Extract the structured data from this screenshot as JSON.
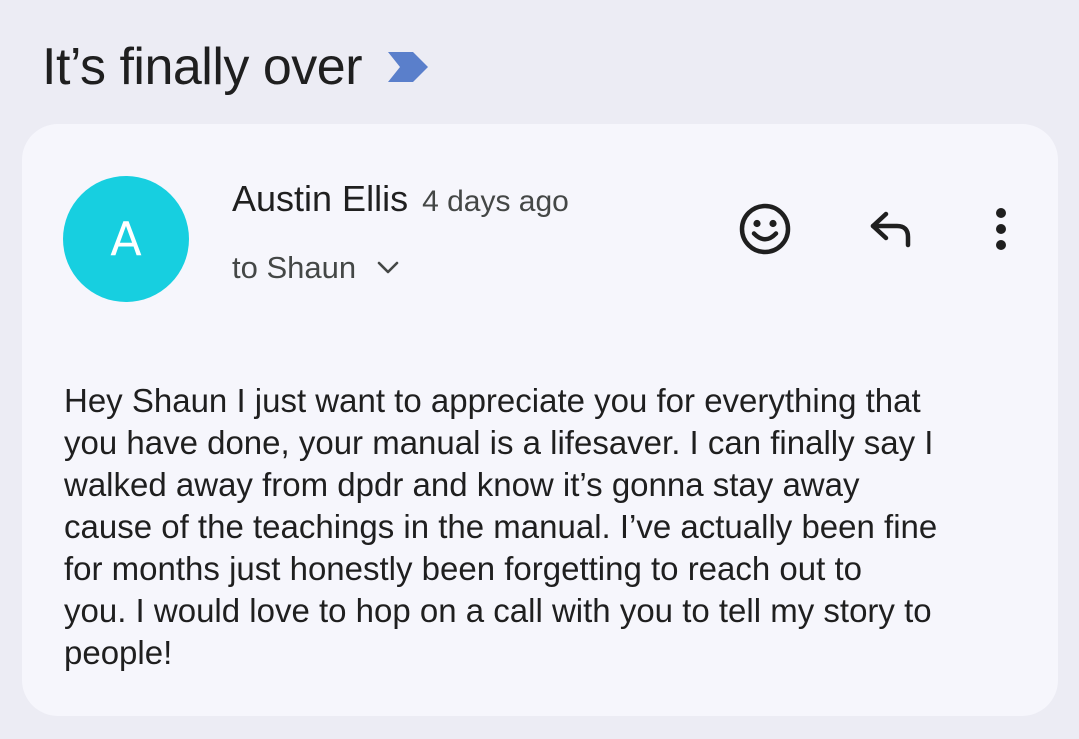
{
  "thread": {
    "subject": "It’s finally over",
    "label_icon": "importance-marker-icon",
    "label_color": "#5a7fcb"
  },
  "message": {
    "avatar_initial": "A",
    "avatar_color": "#17cfe0",
    "sender_name": "Austin Ellis",
    "sent_time": "4 days ago",
    "recipient": "to Shaun",
    "body": "Hey Shaun I just want to appreciate you for everything that\nyou have done, your manual is a lifesaver. I can finally say I\nwalked away from dpdr and know it’s gonna stay away\ncause of the teachings in the manual. I’ve actually been fine\nfor months just honestly been forgetting to reach out to\nyou. I would love to hop on a call with you to tell my story to\npeople!"
  },
  "actions": {
    "emoji_icon": "add-reaction-icon",
    "reply_icon": "reply-icon",
    "more_icon": "more-vert-icon"
  },
  "colors": {
    "background": "#ececf4",
    "card": "#f6f6fc",
    "text": "#1f1f1f",
    "secondary_text": "#444746"
  }
}
